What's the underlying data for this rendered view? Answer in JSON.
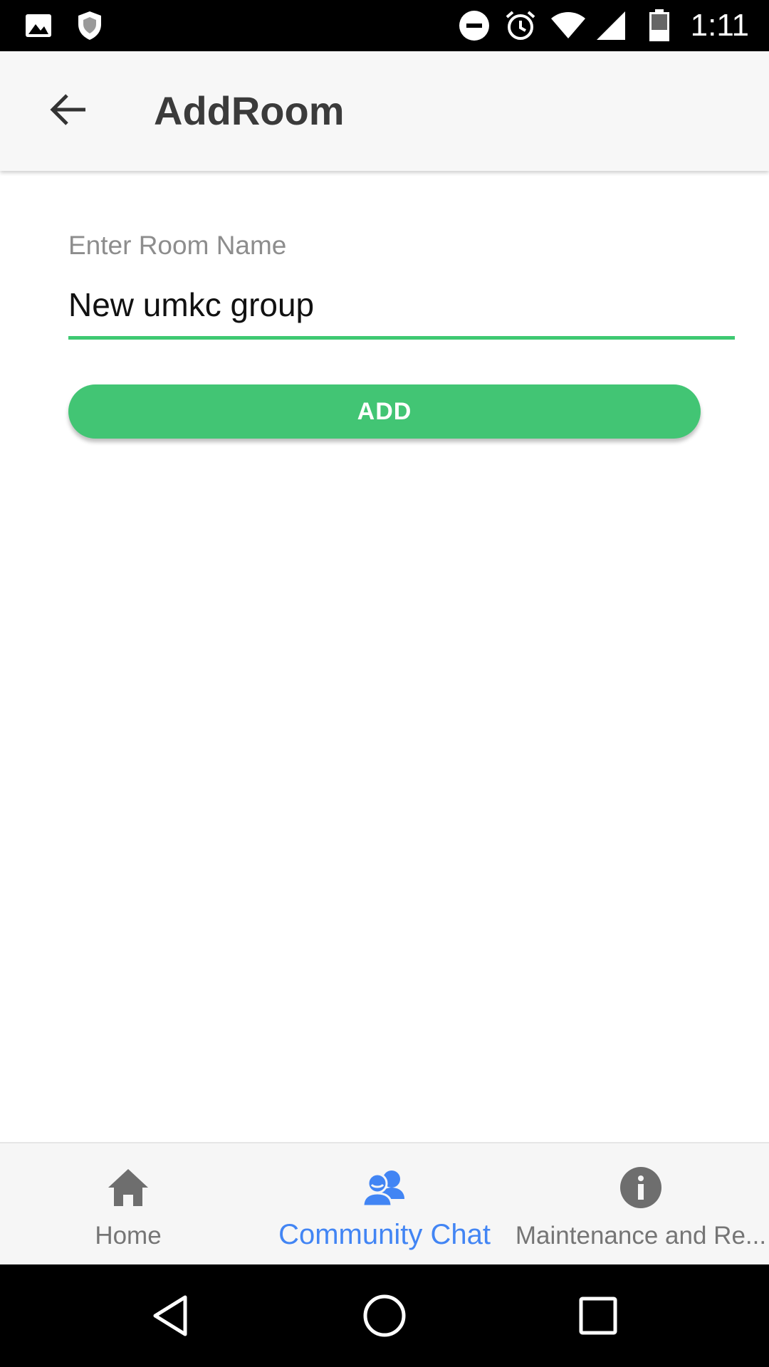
{
  "status_bar": {
    "time": "1:11",
    "icons": [
      "image-icon",
      "shield-icon",
      "do-not-disturb-icon",
      "alarm-icon",
      "wifi-icon",
      "cell-signal-icon",
      "battery-icon"
    ]
  },
  "app_bar": {
    "back_icon": "arrow-back-icon",
    "title": "AddRoom"
  },
  "form": {
    "room_name_label": "Enter Room Name",
    "room_name_value": "New umkc group",
    "add_button_label": "ADD"
  },
  "bottom_nav": {
    "tabs": [
      {
        "label": "Home",
        "icon": "home-icon",
        "active": false
      },
      {
        "label": "Community Chat",
        "icon": "community-chat-icon",
        "active": true
      },
      {
        "label": "Maintenance and Re...",
        "icon": "info-icon",
        "active": false
      }
    ]
  },
  "system_nav": {
    "buttons": [
      "back-triangle-icon",
      "home-circle-icon",
      "recents-square-icon"
    ]
  },
  "colors": {
    "accent_green": "#42c574",
    "active_tab_blue": "#4285f4",
    "inactive_tab_gray": "#757575"
  }
}
